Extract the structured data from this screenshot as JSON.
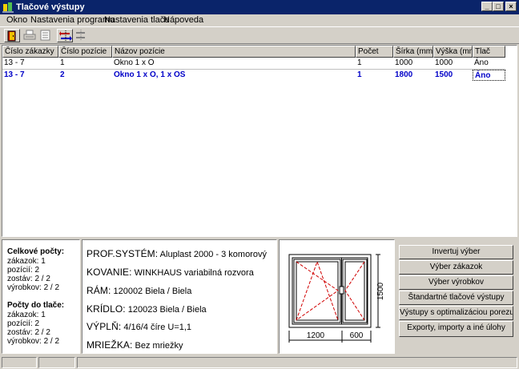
{
  "window": {
    "title": "Tlačové výstupy"
  },
  "menu": {
    "items": [
      "Okno",
      "Nastavenia programu",
      "Nastavenia tlače",
      "Nápoveda"
    ]
  },
  "toolbar": {
    "buttons": [
      "exit-icon",
      "print-icon",
      "print-preview-icon",
      "swap-arrows-icon",
      "swap-arrows-disabled-icon"
    ]
  },
  "table": {
    "columns": [
      "Číslo zákazky",
      "Číslo pozície",
      "Názov pozície",
      "Počet",
      "Šírka (mm)",
      "Výška (mm)",
      "Tlač"
    ],
    "rows": [
      {
        "zakazka": "13    - 7",
        "pozicia": "1",
        "nazov": "Okno 1 x O",
        "pocet": "1",
        "sirka": "1000",
        "vyska": "1000",
        "tlac": "Áno"
      },
      {
        "zakazka": "13    - 7",
        "pozicia": "2",
        "nazov": "Okno 1 x O, 1 x OS",
        "pocet": "1",
        "sirka": "1800",
        "vyska": "1500",
        "tlac": "Áno"
      }
    ]
  },
  "counts": {
    "total_title": "Celkové počty:",
    "total_lines": [
      "zákazok: 1",
      "pozícií: 2",
      "zostáv: 2 / 2",
      "výrobkov: 2 / 2"
    ],
    "print_title": "Počty do tlače:",
    "print_lines": [
      "zákazok: 1",
      "pozícií: 2",
      "zostáv: 2 / 2",
      "výrobkov: 2 / 2"
    ]
  },
  "info": [
    {
      "label": "PROF.SYSTÉM:",
      "value": "Aluplast 2000 - 3 komorový"
    },
    {
      "label": "KOVANIE:",
      "value": "WINKHAUS variabilná rozvora"
    },
    {
      "label": "RÁM:",
      "value": "120002 Biela / Biela"
    },
    {
      "label": "KRÍDLO:",
      "value": "120023 Biela / Biela"
    },
    {
      "label": "VÝPLŇ:",
      "value": "4/16/4 číre U=1,1"
    },
    {
      "label": "MRIEŽKA:",
      "value": "Bez mriežky"
    }
  ],
  "drawing": {
    "dim_left": "1200",
    "dim_right": "600",
    "dim_height": "1500"
  },
  "buttons": [
    "Invertuj výber",
    "Výber zákazok",
    "Výber výrobkov",
    "Štandartné tlačové výstupy",
    "Výstupy s optimalizáciou porezu",
    "Exporty, importy a iné úlohy"
  ],
  "colors": {
    "title_bar": "#0a246a",
    "selected_row": "#0000c8",
    "face": "#d4d0c8"
  }
}
